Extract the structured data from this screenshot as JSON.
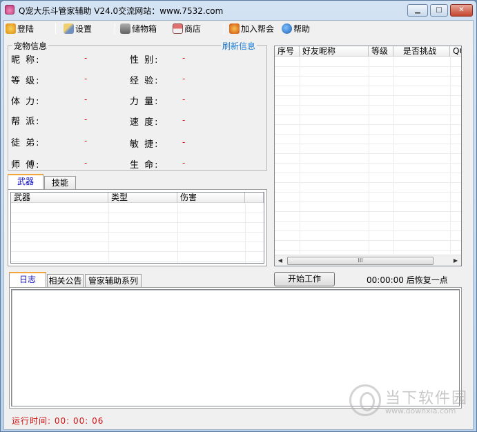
{
  "window": {
    "title": "Q宠大乐斗管家辅助 V24.0交流网站：www.7532.com",
    "minimize": "▁",
    "maximize": "□",
    "close": "✕"
  },
  "toolbar": {
    "items": [
      {
        "label": "登陆",
        "icon": "login-icon",
        "color": "#e8a020"
      },
      {
        "label": "设置",
        "icon": "wrench-icon",
        "color": "#d0a030"
      },
      {
        "label": "储物箱",
        "icon": "storage-box-icon",
        "color": "#888888"
      },
      {
        "label": "商店",
        "icon": "shop-icon",
        "color": "#a04040"
      },
      {
        "label": "加入帮会",
        "icon": "guild-icon",
        "color": "#e08020"
      },
      {
        "label": "帮助",
        "icon": "help-icon",
        "color": "#2a7ad0"
      }
    ]
  },
  "pet_info": {
    "title": "宠物信息",
    "refresh": "刷新信息",
    "left": [
      {
        "label": "昵 称:",
        "value": "-"
      },
      {
        "label": "等 级:",
        "value": "-"
      },
      {
        "label": "体 力:",
        "value": "-"
      },
      {
        "label": "帮 派:",
        "value": "-"
      },
      {
        "label": "徒 弟:",
        "value": "-"
      },
      {
        "label": "师 傅:",
        "value": "-"
      }
    ],
    "right": [
      {
        "label": "性 别:",
        "value": "-"
      },
      {
        "label": "经 验:",
        "value": "-"
      },
      {
        "label": "力 量:",
        "value": "-"
      },
      {
        "label": "速 度:",
        "value": "-"
      },
      {
        "label": "敏 捷:",
        "value": "-"
      },
      {
        "label": "生 命:",
        "value": "-"
      }
    ]
  },
  "equip_tabs": {
    "tabs": [
      "武器",
      "技能"
    ],
    "active": "武器",
    "columns": [
      "武器",
      "类型",
      "伤害"
    ]
  },
  "friends_table": {
    "columns": [
      "序号",
      "好友昵称",
      "等级",
      "是否挑战",
      "QQ"
    ],
    "scroll_thumb": "III"
  },
  "controls": {
    "start_button": "开始工作",
    "restore_text": "00:00:00 后恢复一点"
  },
  "log_tabs": {
    "tabs": [
      "日志",
      "相关公告",
      "管家辅助系列"
    ],
    "active": "日志"
  },
  "status": {
    "runtime": "运行时间: 00: 00: 06"
  },
  "watermark": {
    "text": "当下软件园",
    "url": "www.downxia.com"
  }
}
